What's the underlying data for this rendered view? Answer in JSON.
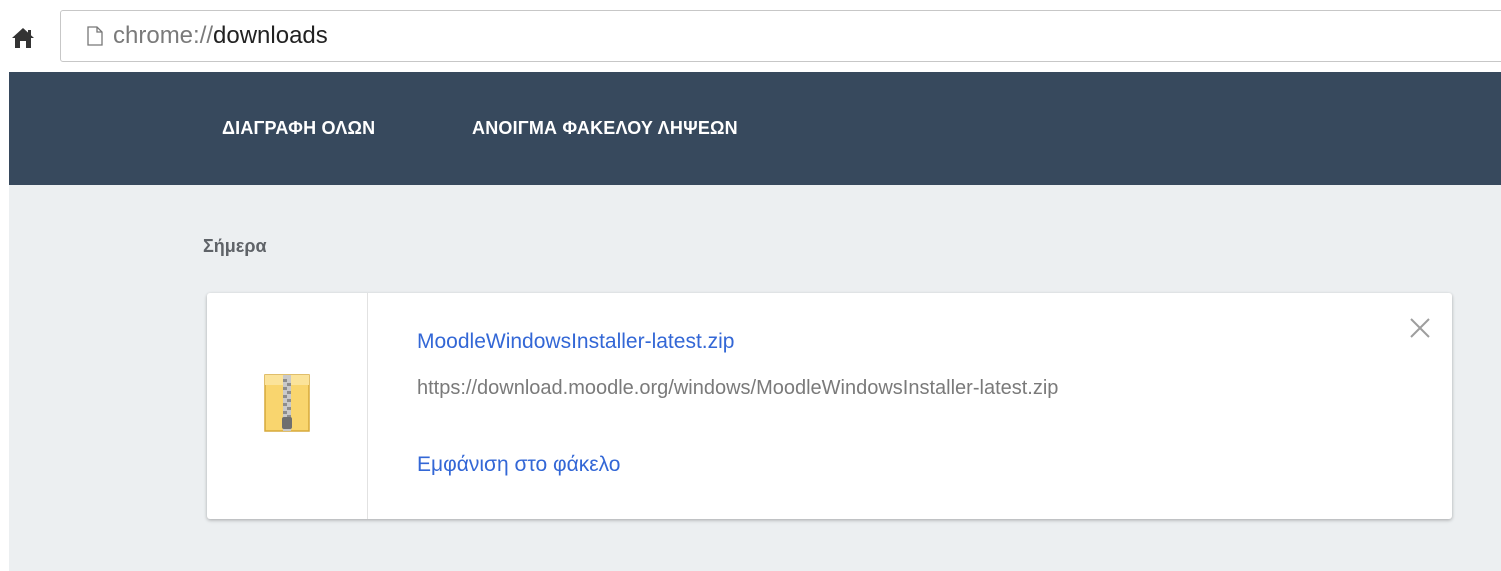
{
  "omnibox": {
    "scheme": "chrome://",
    "host": "downloads",
    "home_icon": "home-icon",
    "page_icon": "page-icon"
  },
  "toolbar": {
    "clear_all_label": "ΔΙΑΓΡΑΦΗ ΟΛΩΝ",
    "open_folder_label": "ΑΝΟΙΓΜΑ ΦΑΚΕΛΟΥ ΛΗΨΕΩΝ"
  },
  "downloads": {
    "section_title": "Σήμερα",
    "items": [
      {
        "file_name": "MoodleWindowsInstaller-latest.zip",
        "url": "https://download.moodle.org/windows/MoodleWindowsInstaller-latest.zip",
        "show_in_folder_label": "Εμφάνιση στο φάκελο",
        "file_icon": "zip-file-icon",
        "close_icon": "close-icon"
      }
    ]
  },
  "colors": {
    "toolbar_bg": "#37495d",
    "page_bg": "#eceff1",
    "link": "#3367d6",
    "muted_text": "#7a7a7a"
  }
}
